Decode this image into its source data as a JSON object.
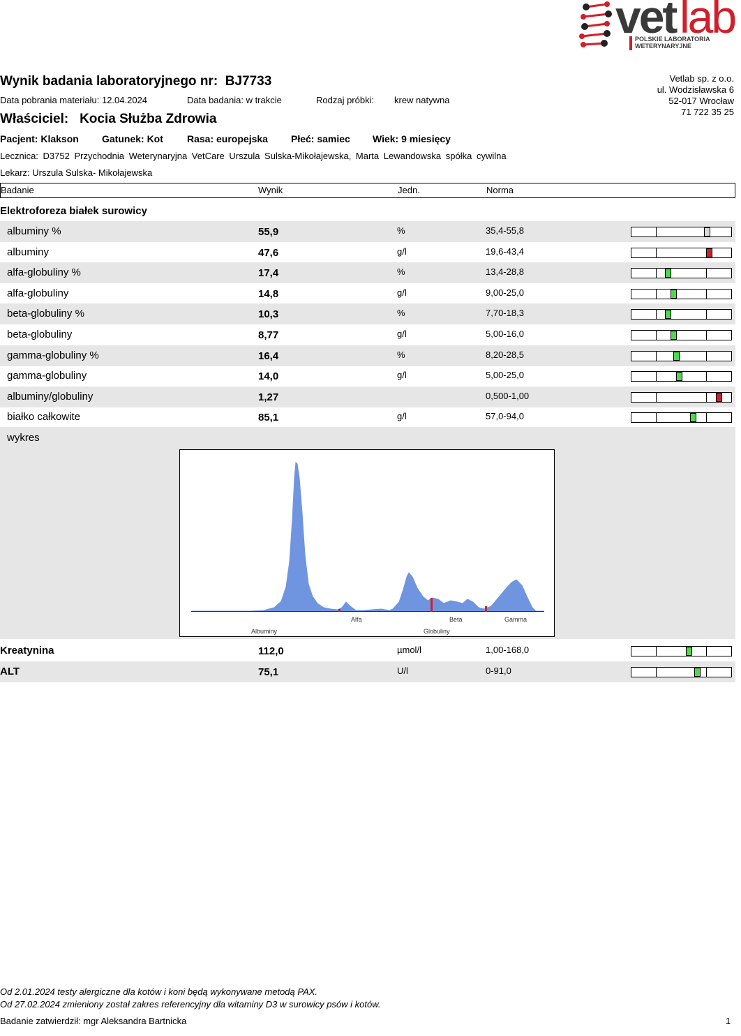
{
  "logo": {
    "brand_a": "vet",
    "brand_b": "lab",
    "tagline1": "POLSKIE LABORATORIA",
    "tagline2": "WETERYNARYJNE"
  },
  "report": {
    "title_label": "Wynik badania laboratoryjnego nr:",
    "number": "BJ7733",
    "collection_date": "Data pobrania materiału: 12.04.2024",
    "test_date": "Data badania: w trakcie",
    "sample_type_label": "Rodzaj próbki:",
    "sample_type": "krew natywna",
    "owner_label": "Właściciel:",
    "owner": "Kocia Służba Zdrowia",
    "patient": "Pacjent: Klakson",
    "species": "Gatunek: Kot",
    "breed": "Rasa: europejska",
    "sex": "Płeć: samiec",
    "age": "Wiek: 9 miesięcy",
    "clinic": "Lecznica: D3752 Przychodnia Weterynaryjna VetCare Urszula Sulska-Mikołajewska, Marta Lewandowska spółka cywilna",
    "doctor": "Lekarz: Urszula Sulska- Mikołajewska"
  },
  "lab_address": [
    "Vetlab sp. z o.o.",
    "ul. Wodzisławska 6",
    "52-017 Wrocław",
    "71 722 35 25"
  ],
  "columns": {
    "test": "Badanie",
    "result": "Wynik",
    "unit": "Jedn.",
    "norm": "Norma"
  },
  "section_title": "Elektroforeza białek surowicy",
  "results": [
    {
      "name": "albuminy %",
      "value": "55,9",
      "unit": "%",
      "norm": "35,4-55,8",
      "status": "edge"
    },
    {
      "name": "albuminy",
      "value": "47,6",
      "unit": "g/l",
      "norm": "19,6-43,4",
      "status": "high"
    },
    {
      "name": "alfa-globuliny %",
      "value": "17,4",
      "unit": "%",
      "norm": "13,4-28,8",
      "status": "normal"
    },
    {
      "name": "alfa-globuliny",
      "value": "14,8",
      "unit": "g/l",
      "norm": "9,00-25,0",
      "status": "normal"
    },
    {
      "name": "beta-globuliny %",
      "value": "10,3",
      "unit": "%",
      "norm": "7,70-18,3",
      "status": "normal"
    },
    {
      "name": "beta-globuliny",
      "value": "8,77",
      "unit": "g/l",
      "norm": "5,00-16,0",
      "status": "normal"
    },
    {
      "name": "gamma-globuliny %",
      "value": "16,4",
      "unit": "%",
      "norm": "8,20-28,5",
      "status": "normal"
    },
    {
      "name": "gamma-globuliny",
      "value": "14,0",
      "unit": "g/l",
      "norm": "5,00-25,0",
      "status": "normal"
    },
    {
      "name": "albuminy/globuliny",
      "value": "1,27",
      "unit": "",
      "norm": "0,500-1,00",
      "status": "high"
    },
    {
      "name": "białko całkowite",
      "value": "85,1",
      "unit": "g/l",
      "norm": "57,0-94,0",
      "status": "normal"
    }
  ],
  "chart_label": "wykres",
  "chart_labels": {
    "albuminy": "Albuminy",
    "alfa": "Alfa",
    "beta": "Beta",
    "gamma": "Gamma",
    "globuliny": "Globuliny"
  },
  "other_results": [
    {
      "name": "Kreatynina",
      "value": "112,0",
      "unit": "µmol/l",
      "norm": "1,00-168,0",
      "status": "normal"
    },
    {
      "name": "ALT",
      "value": "75,1",
      "unit": "U/l",
      "norm": "0-91,0",
      "status": "normal"
    }
  ],
  "colors": {
    "normal": "#4cd94c",
    "high": "#d01f2a",
    "edge": "#d9d9d9",
    "chart_fill": "#6f95e0"
  },
  "footer": {
    "note1": "Od 2.01.2024 testy alergiczne dla kotów i koni będą wykonywane metodą PAX.",
    "note2": "Od 27.02.2024 zmieniony został zakres referencyjny dla witaminy D3 w surowicy psów i kotów.",
    "approved": "Badanie zatwierdził: mgr Aleksandra Bartnicka",
    "page": "1"
  }
}
